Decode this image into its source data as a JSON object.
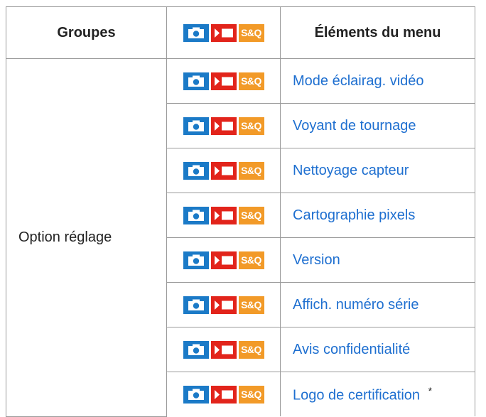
{
  "header": {
    "groups": "Groupes",
    "items": "Éléments du menu",
    "mode_icons": [
      {
        "icon": "camera-icon",
        "color": "#1b7ac7"
      },
      {
        "icon": "movie-icon",
        "color": "#e2241b"
      },
      {
        "icon": "sq-icon",
        "label": "S&Q",
        "color": "#f29a28"
      }
    ]
  },
  "group_label": "Option réglage",
  "sq_label": "S&Q",
  "rows": [
    {
      "label": "Mode éclairag. vidéo"
    },
    {
      "label": "Voyant de tournage"
    },
    {
      "label": "Nettoyage capteur"
    },
    {
      "label": "Cartographie pixels"
    },
    {
      "label": "Version"
    },
    {
      "label": "Affich. numéro série"
    },
    {
      "label": "Avis confidentialité"
    },
    {
      "label": "Logo de certification",
      "note": "*"
    }
  ],
  "colors": {
    "link": "#1e6fd0",
    "border": "#9a9a9a"
  }
}
